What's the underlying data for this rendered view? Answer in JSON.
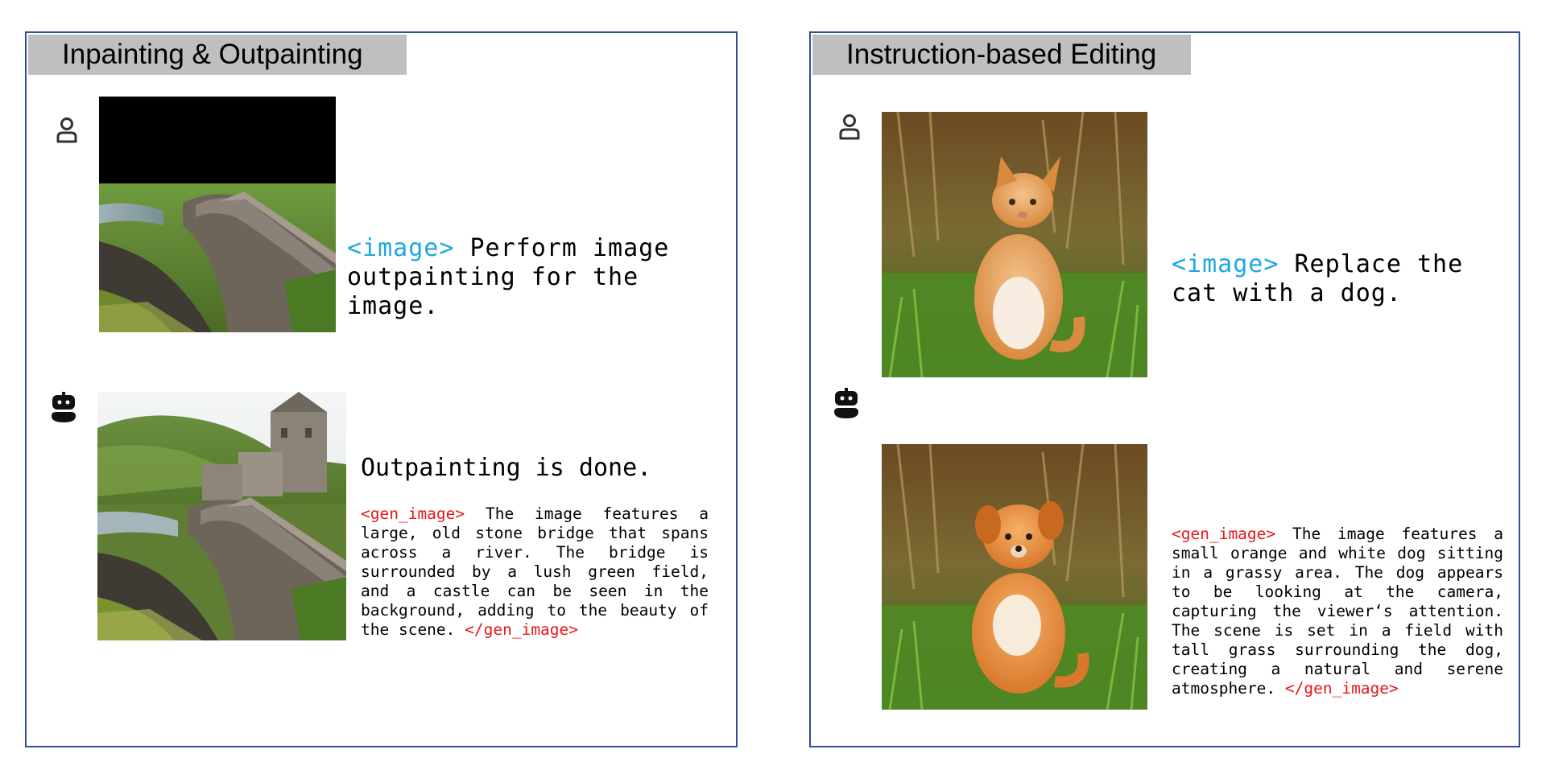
{
  "left_panel": {
    "title": "Inpainting & Outpainting",
    "user_prompt": {
      "tag": "<image>",
      "text": " Perform image outpainting for the image."
    },
    "assistant_heading": "Outpainting is done.",
    "assistant_caption": {
      "open_tag": "<gen_image>",
      "text": " The image features a large, old stone bridge that spans across a river. The bridge is surrounded by a lush green field, and a castle can be seen in the background, adding to the beauty of the scene. ",
      "close_tag": "</gen_image>"
    }
  },
  "right_panel": {
    "title": "Instruction-based Editing",
    "user_prompt": {
      "tag": "<image>",
      "text": " Replace the cat with a dog."
    },
    "assistant_caption": {
      "open_tag": "<gen_image>",
      "text": " The image features a small orange and white dog sitting in a grassy area. The dog appears to be looking at the camera, capturing the viewer‘s attention. The scene is set in a field with tall grass surrounding the dog, creating a natural and serene atmosphere. ",
      "close_tag": "</gen_image>"
    }
  },
  "icons": {
    "user": "user-icon",
    "assistant": "robot-icon"
  },
  "colors": {
    "border": "#2f4f9a",
    "title_bg": "#bfbfbf",
    "tag_blue": "#1ea7e1",
    "tag_red": "#e8161b"
  }
}
